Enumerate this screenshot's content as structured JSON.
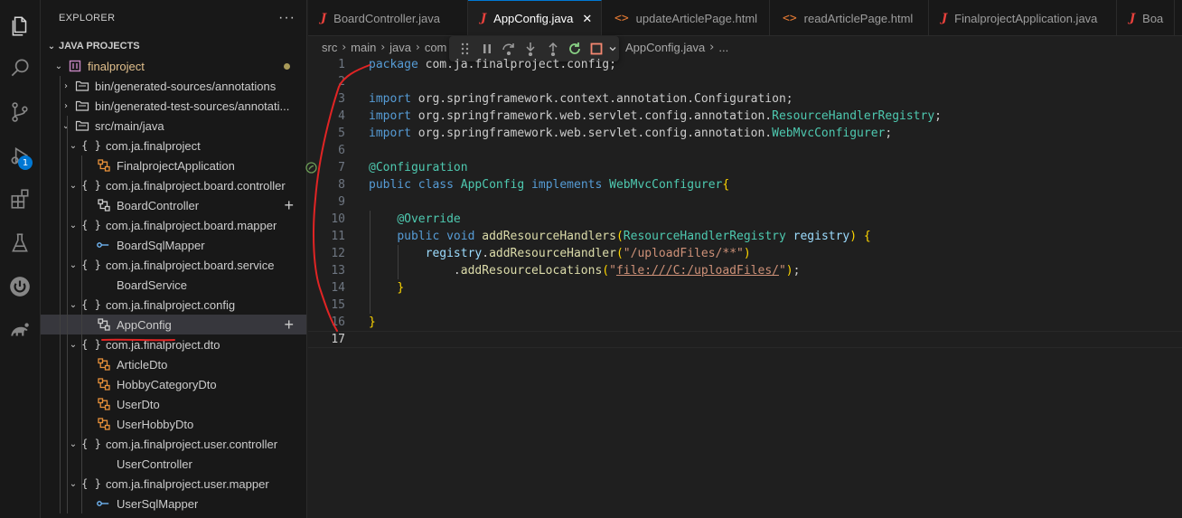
{
  "activity_bar": {
    "icons": [
      "explorer-icon",
      "search-icon",
      "source-control-icon",
      "run-debug-icon",
      "extensions-icon",
      "testing-icon",
      "spring-boot-icon",
      "gradle-icon"
    ],
    "debug_badge": "1"
  },
  "explorer": {
    "title": "EXPLORER",
    "more": "···",
    "section": "JAVA PROJECTS",
    "tree": [
      {
        "label": "finalproject",
        "kind": "project",
        "depth": 0,
        "chevron": "⌄"
      },
      {
        "label": "bin/generated-sources/annotations",
        "kind": "folder",
        "depth": 1,
        "chevron": "›"
      },
      {
        "label": "bin/generated-test-sources/annotati...",
        "kind": "folder",
        "depth": 1,
        "chevron": "›"
      },
      {
        "label": "src/main/java",
        "kind": "folder",
        "depth": 1,
        "chevron": "⌄"
      },
      {
        "label": "com.ja.finalproject",
        "kind": "package",
        "depth": 2,
        "chevron": "⌄"
      },
      {
        "label": "FinalprojectApplication",
        "kind": "class",
        "depth": 3
      },
      {
        "label": "com.ja.finalproject.board.controller",
        "kind": "package",
        "depth": 2,
        "chevron": "⌄"
      },
      {
        "label": "BoardController",
        "kind": "class-white",
        "depth": 3
      },
      {
        "label": "com.ja.finalproject.board.mapper",
        "kind": "package",
        "depth": 2,
        "chevron": "⌄"
      },
      {
        "label": "BoardSqlMapper",
        "kind": "interface",
        "depth": 3
      },
      {
        "label": "com.ja.finalproject.board.service",
        "kind": "package",
        "depth": 2,
        "chevron": "⌄"
      },
      {
        "label": "BoardService",
        "kind": "none",
        "depth": 3
      },
      {
        "label": "com.ja.finalproject.config",
        "kind": "package",
        "depth": 2,
        "chevron": "⌄"
      },
      {
        "label": "AppConfig",
        "kind": "class-white",
        "depth": 3
      },
      {
        "label": "com.ja.finalproject.dto",
        "kind": "package",
        "depth": 2,
        "chevron": "⌄"
      },
      {
        "label": "ArticleDto",
        "kind": "class",
        "depth": 3
      },
      {
        "label": "HobbyCategoryDto",
        "kind": "class",
        "depth": 3
      },
      {
        "label": "UserDto",
        "kind": "class",
        "depth": 3
      },
      {
        "label": "UserHobbyDto",
        "kind": "class",
        "depth": 3
      },
      {
        "label": "com.ja.finalproject.user.controller",
        "kind": "package",
        "depth": 2,
        "chevron": "⌄"
      },
      {
        "label": "UserController",
        "kind": "none",
        "depth": 3
      },
      {
        "label": "com.ja.finalproject.user.mapper",
        "kind": "package",
        "depth": 2,
        "chevron": "⌄"
      },
      {
        "label": "UserSqlMapper",
        "kind": "interface",
        "depth": 3
      }
    ],
    "selected": "AppConfig"
  },
  "tabs": [
    {
      "label": "BoardController.java",
      "type": "java"
    },
    {
      "label": "AppConfig.java",
      "type": "java",
      "active": true
    },
    {
      "label": "updateArticlePage.html",
      "type": "html"
    },
    {
      "label": "readArticlePage.html",
      "type": "html"
    },
    {
      "label": "FinalprojectApplication.java",
      "type": "java"
    },
    {
      "label": "Boa",
      "type": "java"
    }
  ],
  "tab_close": "✕",
  "breadcrumb": {
    "parts": [
      "src",
      "main",
      "java",
      "com"
    ],
    "after": "AppConfig.java",
    "trail": "..."
  },
  "debug_toolbar": [
    "drag-grip-icon",
    "pause-icon",
    "step-over-icon",
    "step-into-icon",
    "step-out-icon",
    "restart-icon",
    "stop-icon",
    "chevron-down-icon"
  ],
  "code": {
    "current_line": 17,
    "lines": [
      {
        "n": "1",
        "text": "package com.ja.finalproject.config;"
      },
      {
        "n": "2",
        "text": ""
      },
      {
        "n": "3",
        "text": "import org.springframework.context.annotation.Configuration;"
      },
      {
        "n": "4",
        "text": "import org.springframework.web.servlet.config.annotation.ResourceHandlerRegistry;"
      },
      {
        "n": "5",
        "text": "import org.springframework.web.servlet.config.annotation.WebMvcConfigurer;"
      },
      {
        "n": "6",
        "text": ""
      },
      {
        "n": "7",
        "text": "@Configuration"
      },
      {
        "n": "8",
        "text": "public class AppConfig implements WebMvcConfigurer{"
      },
      {
        "n": "9",
        "text": ""
      },
      {
        "n": "10",
        "text": "    @Override"
      },
      {
        "n": "11",
        "text": "    public void addResourceHandlers(ResourceHandlerRegistry registry) {"
      },
      {
        "n": "12",
        "text": "        registry.addResourceHandler(\"/uploadFiles/**\")"
      },
      {
        "n": "13",
        "text": "            .addResourceLocations(\"file:///C:/uploadFiles/\");"
      },
      {
        "n": "14",
        "text": "    }"
      },
      {
        "n": "15",
        "text": ""
      },
      {
        "n": "16",
        "text": "}"
      },
      {
        "n": "17",
        "text": ""
      }
    ]
  },
  "colors": {
    "accent": "#0078d4",
    "annotation_ink": "#e02424",
    "java_icon": "#e8413c",
    "class_icon": "#e8913a"
  }
}
